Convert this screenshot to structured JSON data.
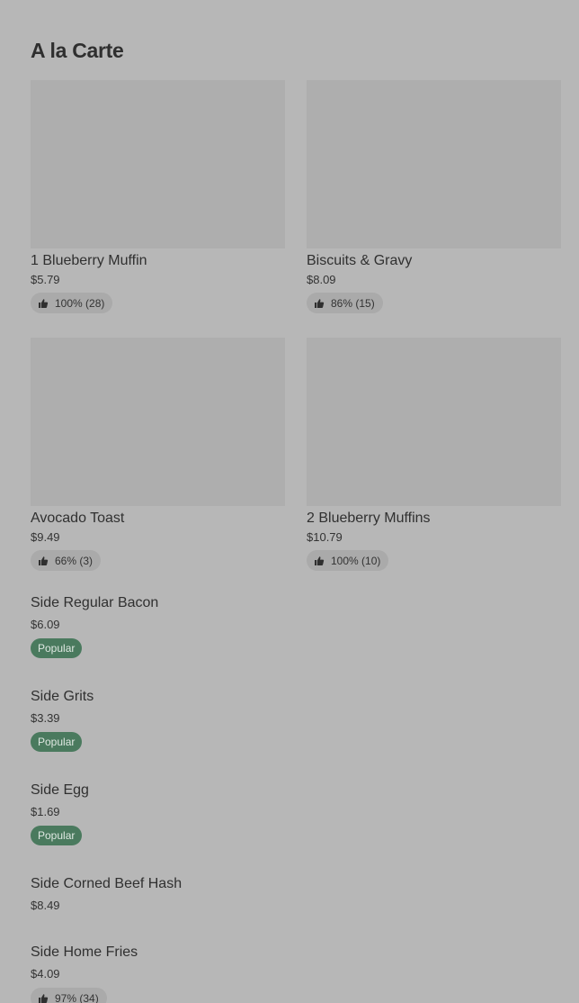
{
  "section": {
    "title": "A la Carte"
  },
  "cards": [
    {
      "name": "1 Blueberry Muffin",
      "price": "$5.79",
      "rating": "100% (28)"
    },
    {
      "name": "Biscuits & Gravy",
      "price": "$8.09",
      "rating": "86% (15)"
    },
    {
      "name": "Avocado Toast",
      "price": "$9.49",
      "rating": "66% (3)"
    },
    {
      "name": "2 Blueberry Muffins",
      "price": "$10.79",
      "rating": "100% (10)"
    }
  ],
  "list": [
    {
      "name": "Side Regular Bacon",
      "price": "$6.09",
      "badge": "Popular"
    },
    {
      "name": "Side Grits",
      "price": "$3.39",
      "badge": "Popular"
    },
    {
      "name": "Side Egg",
      "price": "$1.69",
      "badge": "Popular"
    },
    {
      "name": "Side Corned Beef Hash",
      "price": "$8.49"
    },
    {
      "name": "Side Home Fries",
      "price": "$4.09",
      "rating": "97% (34)"
    }
  ],
  "icons": {
    "rating": "thumbs-up-icon"
  },
  "colors": {
    "background": "#b7b7b7",
    "image_placeholder": "#aeaeae",
    "popular_badge": "#4a7a5e",
    "rating_pill": "#aaaaaa"
  }
}
